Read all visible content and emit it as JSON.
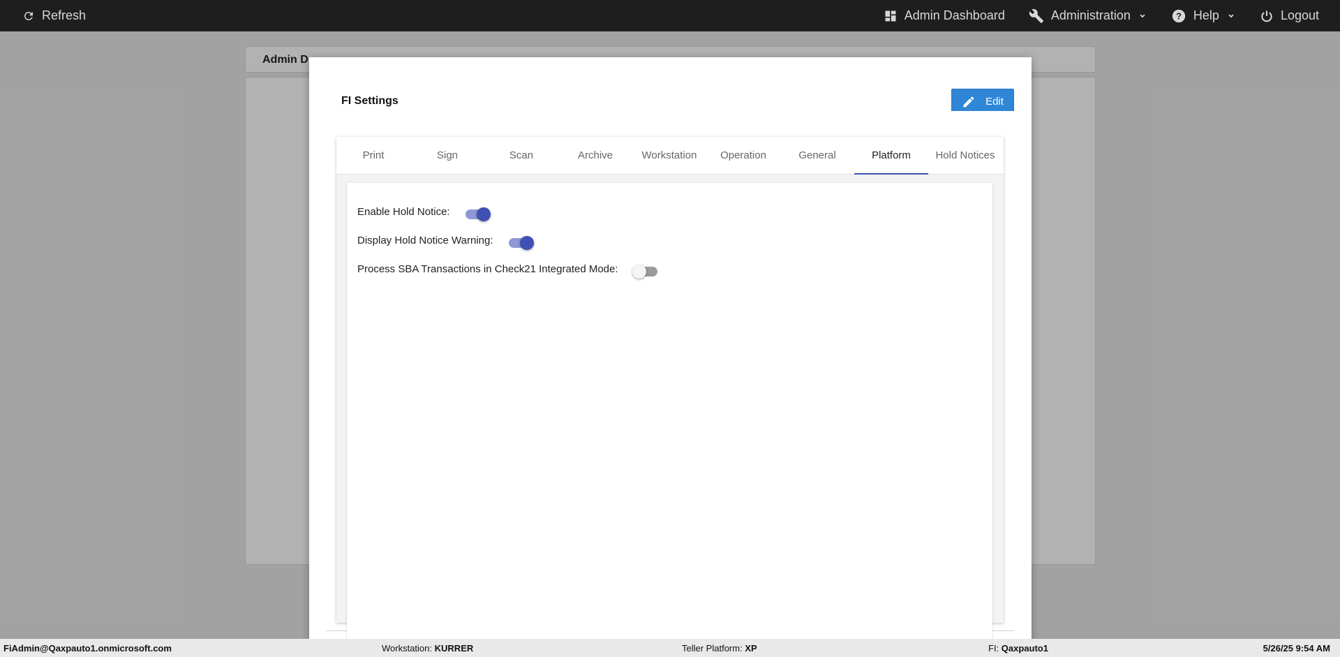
{
  "topbar": {
    "refresh_label": "Refresh",
    "admin_dashboard_label": "Admin Dashboard",
    "administration_label": "Administration",
    "help_label": "Help",
    "logout_label": "Logout"
  },
  "background": {
    "header_title": "Admin D"
  },
  "modal": {
    "title": "FI Settings",
    "edit_label": "Edit",
    "tabs": [
      {
        "label": "Print",
        "active": false
      },
      {
        "label": "Sign",
        "active": false
      },
      {
        "label": "Scan",
        "active": false
      },
      {
        "label": "Archive",
        "active": false
      },
      {
        "label": "Workstation",
        "active": false
      },
      {
        "label": "Operation",
        "active": false
      },
      {
        "label": "General",
        "active": false
      },
      {
        "label": "Platform",
        "active": true
      },
      {
        "label": "Hold Notices",
        "active": false
      }
    ],
    "settings": [
      {
        "label": "Enable Hold Notice:",
        "enabled": true
      },
      {
        "label": "Display Hold Notice Warning:",
        "enabled": true
      },
      {
        "label": "Process SBA Transactions in Check21 Integrated Mode:",
        "enabled": false
      }
    ]
  },
  "footer": {
    "user": "FiAdmin@Qaxpauto1.onmicrosoft.com",
    "workstation_label": "Workstation:",
    "workstation_value": "KURRER",
    "platform_label": "Teller Platform:",
    "platform_value": "XP",
    "fi_label": "FI:",
    "fi_value": "Qaxpauto1",
    "datetime": "5/26/25 9:54 AM"
  },
  "colors": {
    "accent": "#3f51b5",
    "edit_button": "#2f86d6",
    "topbar": "#1e1e1e"
  }
}
